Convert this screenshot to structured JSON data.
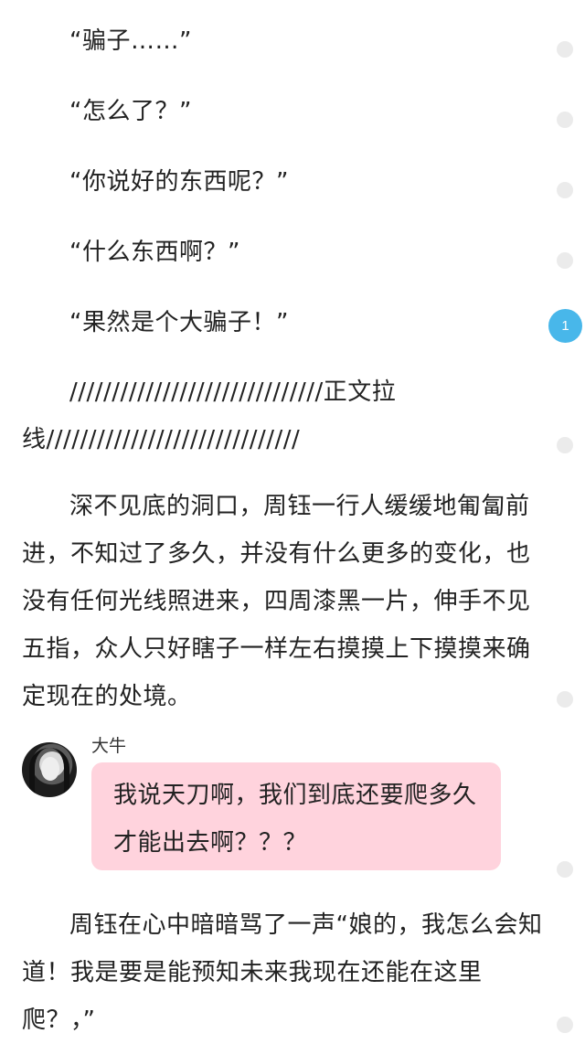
{
  "dialogue": [
    "“骗子……”",
    "“怎么了？”",
    "“你说好的东西呢？”",
    "“什么东西啊？”",
    "“果然是个大骗子！”"
  ],
  "divider": {
    "line1": "//////////////////////////////正文拉",
    "line2": "线//////////////////////////////"
  },
  "paragraph1": "深不见底的洞口，周钰一行人缓缓地匍匐前进，不知过了多久，并没有什么更多的变化，也没有任何光线照进来，四周漆黑一片，伸手不见五指，众人只好瞎子一样左右摸摸上下摸摸来确定现在的处境。",
  "comment": {
    "author": "大牛",
    "text": "我说天刀啊，我们到底还要爬多久才能出去啊？？？"
  },
  "paragraph2": "周钰在心中暗暗骂了一声“娘的，我怎么会知道！我是要是能预知未来我现在还能在这里爬？，”",
  "side_markers": {
    "active_count": "1",
    "color_active": "#48b7ea",
    "color_inactive": "#ebebeb"
  }
}
